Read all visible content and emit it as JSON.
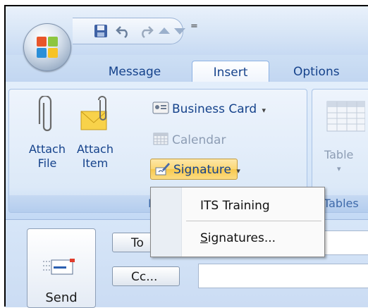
{
  "tabs": {
    "message": "Message",
    "insert": "Insert",
    "options": "Options"
  },
  "ribbon": {
    "attach_file": {
      "line1": "Attach",
      "line2": "File"
    },
    "attach_item": {
      "line1": "Attach",
      "line2": "Item"
    },
    "business_card": "Business Card",
    "calendar": "Calendar",
    "signature": "Signature",
    "table": "Table",
    "include_group_label": "Incl",
    "tables_group_label": "Tables"
  },
  "signature_menu": {
    "items": [
      "ITS Training",
      "Signatures..."
    ]
  },
  "compose": {
    "send_label": "Send",
    "to_label": "To",
    "cc_label": "Cc..."
  },
  "qat": {
    "dropdown_glyph": "="
  },
  "colors": {
    "accent": "#15428b",
    "highlight": "#fbd773"
  }
}
